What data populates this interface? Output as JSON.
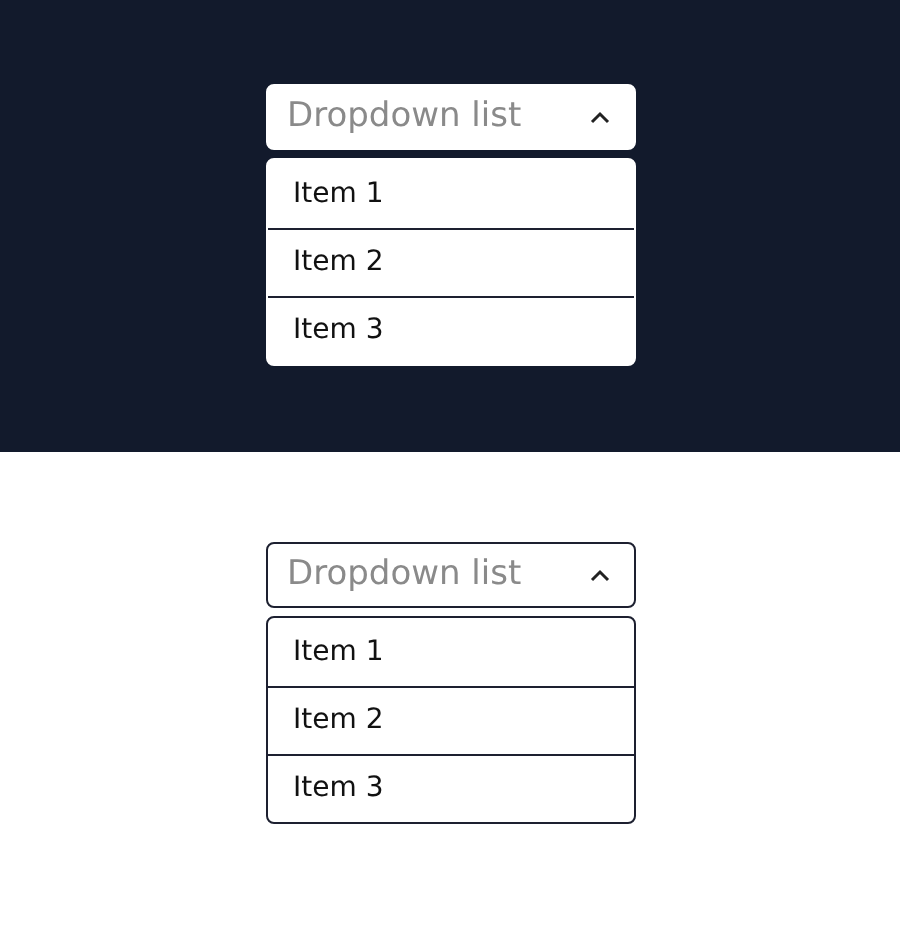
{
  "panels": [
    {
      "kind": "dark",
      "dropdown": {
        "label": "Dropdown list",
        "expanded": true,
        "items": [
          {
            "label": "Item 1"
          },
          {
            "label": "Item 2"
          },
          {
            "label": "Item 3"
          }
        ]
      }
    },
    {
      "kind": "light",
      "dropdown": {
        "label": "Dropdown list",
        "expanded": true,
        "items": [
          {
            "label": "Item 1"
          },
          {
            "label": "Item 2"
          },
          {
            "label": "Item 3"
          }
        ]
      }
    }
  ]
}
